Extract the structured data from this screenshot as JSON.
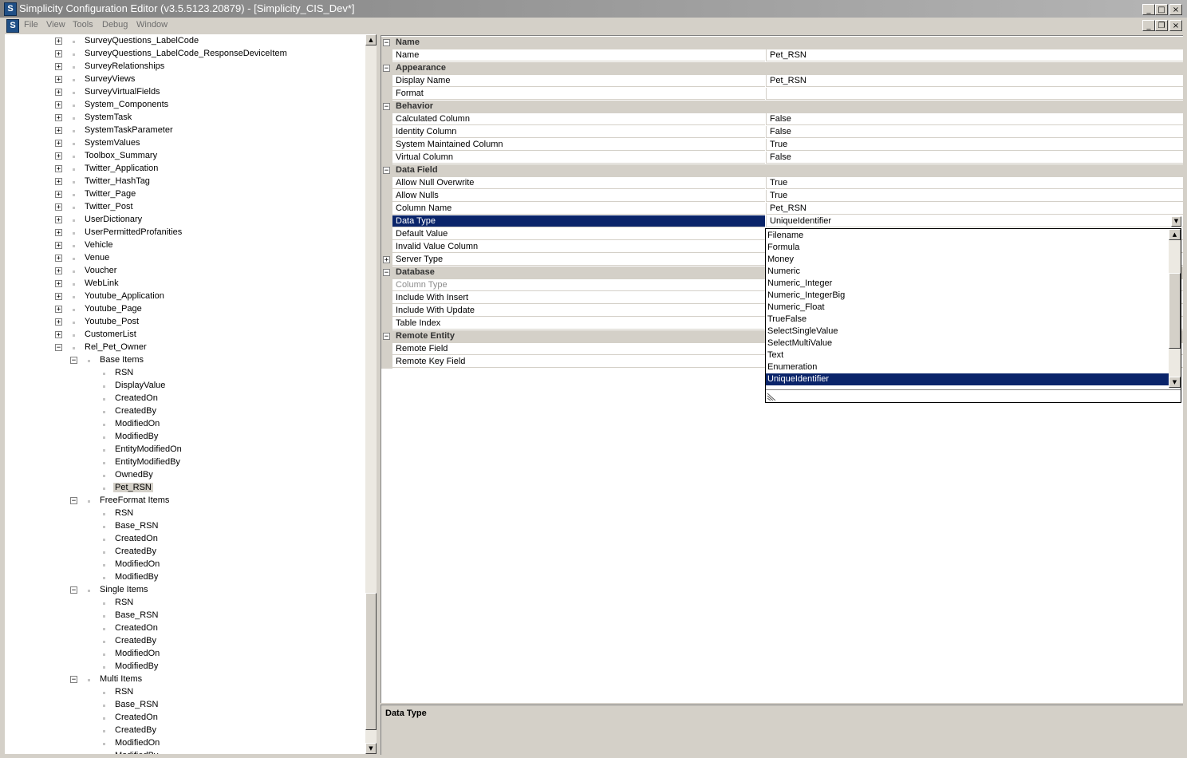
{
  "window": {
    "title": "Simplicity Configuration Editor (v3.5.5123.20879) - [Simplicity_CIS_Dev*]",
    "app_icon_letter": "S",
    "caption_buttons": [
      "_",
      "□",
      "×"
    ]
  },
  "menu": {
    "items": [
      "File",
      "View",
      "Tools",
      "Debug",
      "Window"
    ],
    "mdi_buttons": [
      "_",
      "❐",
      "×"
    ]
  },
  "tree": {
    "nodes": [
      {
        "label": "SurveyQuestions_LabelCode",
        "level": 0,
        "expander": "+"
      },
      {
        "label": "SurveyQuestions_LabelCode_ResponseDeviceItem",
        "level": 0,
        "expander": "+"
      },
      {
        "label": "SurveyRelationships",
        "level": 0,
        "expander": "+"
      },
      {
        "label": "SurveyViews",
        "level": 0,
        "expander": "+"
      },
      {
        "label": "SurveyVirtualFields",
        "level": 0,
        "expander": "+"
      },
      {
        "label": "System_Components",
        "level": 0,
        "expander": "+"
      },
      {
        "label": "SystemTask",
        "level": 0,
        "expander": "+"
      },
      {
        "label": "SystemTaskParameter",
        "level": 0,
        "expander": "+"
      },
      {
        "label": "SystemValues",
        "level": 0,
        "expander": "+"
      },
      {
        "label": "Toolbox_Summary",
        "level": 0,
        "expander": "+"
      },
      {
        "label": "Twitter_Application",
        "level": 0,
        "expander": "+"
      },
      {
        "label": "Twitter_HashTag",
        "level": 0,
        "expander": "+"
      },
      {
        "label": "Twitter_Page",
        "level": 0,
        "expander": "+"
      },
      {
        "label": "Twitter_Post",
        "level": 0,
        "expander": "+"
      },
      {
        "label": "UserDictionary",
        "level": 0,
        "expander": "+"
      },
      {
        "label": "UserPermittedProfanities",
        "level": 0,
        "expander": "+"
      },
      {
        "label": "Vehicle",
        "level": 0,
        "expander": "+"
      },
      {
        "label": "Venue",
        "level": 0,
        "expander": "+"
      },
      {
        "label": "Voucher",
        "level": 0,
        "expander": "+"
      },
      {
        "label": "WebLink",
        "level": 0,
        "expander": "+"
      },
      {
        "label": "Youtube_Application",
        "level": 0,
        "expander": "+"
      },
      {
        "label": "Youtube_Page",
        "level": 0,
        "expander": "+"
      },
      {
        "label": "Youtube_Post",
        "level": 0,
        "expander": "+"
      },
      {
        "label": "CustomerList",
        "level": 0,
        "expander": "+"
      },
      {
        "label": "Rel_Pet_Owner",
        "level": 0,
        "expander": "−"
      },
      {
        "label": "Base Items",
        "level": 1,
        "expander": "−"
      },
      {
        "label": "RSN",
        "level": 2,
        "expander": ""
      },
      {
        "label": "DisplayValue",
        "level": 2,
        "expander": ""
      },
      {
        "label": "CreatedOn",
        "level": 2,
        "expander": ""
      },
      {
        "label": "CreatedBy",
        "level": 2,
        "expander": ""
      },
      {
        "label": "ModifiedOn",
        "level": 2,
        "expander": ""
      },
      {
        "label": "ModifiedBy",
        "level": 2,
        "expander": ""
      },
      {
        "label": "EntityModifiedOn",
        "level": 2,
        "expander": ""
      },
      {
        "label": "EntityModifiedBy",
        "level": 2,
        "expander": ""
      },
      {
        "label": "OwnedBy",
        "level": 2,
        "expander": ""
      },
      {
        "label": "Pet_RSN",
        "level": 2,
        "expander": "",
        "selected": true
      },
      {
        "label": "FreeFormat Items",
        "level": 1,
        "expander": "−"
      },
      {
        "label": "RSN",
        "level": 2,
        "expander": ""
      },
      {
        "label": "Base_RSN",
        "level": 2,
        "expander": ""
      },
      {
        "label": "CreatedOn",
        "level": 2,
        "expander": ""
      },
      {
        "label": "CreatedBy",
        "level": 2,
        "expander": ""
      },
      {
        "label": "ModifiedOn",
        "level": 2,
        "expander": ""
      },
      {
        "label": "ModifiedBy",
        "level": 2,
        "expander": ""
      },
      {
        "label": "Single Items",
        "level": 1,
        "expander": "−"
      },
      {
        "label": "RSN",
        "level": 2,
        "expander": ""
      },
      {
        "label": "Base_RSN",
        "level": 2,
        "expander": ""
      },
      {
        "label": "CreatedOn",
        "level": 2,
        "expander": ""
      },
      {
        "label": "CreatedBy",
        "level": 2,
        "expander": ""
      },
      {
        "label": "ModifiedOn",
        "level": 2,
        "expander": ""
      },
      {
        "label": "ModifiedBy",
        "level": 2,
        "expander": ""
      },
      {
        "label": "Multi Items",
        "level": 1,
        "expander": "−"
      },
      {
        "label": "RSN",
        "level": 2,
        "expander": ""
      },
      {
        "label": "Base_RSN",
        "level": 2,
        "expander": ""
      },
      {
        "label": "CreatedOn",
        "level": 2,
        "expander": ""
      },
      {
        "label": "CreatedBy",
        "level": 2,
        "expander": ""
      },
      {
        "label": "ModifiedOn",
        "level": 2,
        "expander": ""
      },
      {
        "label": "ModifiedBy",
        "level": 2,
        "expander": ""
      }
    ]
  },
  "property_grid": {
    "rows": [
      {
        "type": "category",
        "label": "Name",
        "toggle": "−"
      },
      {
        "type": "property",
        "name": "Name",
        "value": "Pet_RSN"
      },
      {
        "type": "category",
        "label": "Appearance",
        "toggle": "−"
      },
      {
        "type": "property",
        "name": "Display Name",
        "value": "Pet_RSN"
      },
      {
        "type": "property",
        "name": "Format",
        "value": ""
      },
      {
        "type": "category",
        "label": "Behavior",
        "toggle": "−"
      },
      {
        "type": "property",
        "name": "Calculated Column",
        "value": "False"
      },
      {
        "type": "property",
        "name": "Identity Column",
        "value": "False"
      },
      {
        "type": "property",
        "name": "System Maintained Column",
        "value": "True"
      },
      {
        "type": "property",
        "name": "Virtual Column",
        "value": "False"
      },
      {
        "type": "category",
        "label": "Data Field",
        "toggle": "−"
      },
      {
        "type": "property",
        "name": "Allow Null Overwrite",
        "value": "True"
      },
      {
        "type": "property",
        "name": "Allow Nulls",
        "value": "True"
      },
      {
        "type": "property",
        "name": "Column Name",
        "value": "Pet_RSN"
      },
      {
        "type": "property",
        "name": "Data Type",
        "value": "UniqueIdentifier",
        "selected": true,
        "dropdown": true
      },
      {
        "type": "property",
        "name": "Default Value",
        "value": ""
      },
      {
        "type": "property",
        "name": "Invalid Value Column",
        "value": ""
      },
      {
        "type": "property",
        "name": "Server Type",
        "value": "",
        "toggle": "+"
      },
      {
        "type": "category",
        "label": "Database",
        "toggle": "−"
      },
      {
        "type": "property",
        "name": "Column Type",
        "value": "",
        "disabled": true
      },
      {
        "type": "property",
        "name": "Include With Insert",
        "value": ""
      },
      {
        "type": "property",
        "name": "Include With Update",
        "value": ""
      },
      {
        "type": "property",
        "name": "Table Index",
        "value": ""
      },
      {
        "type": "category",
        "label": "Remote Entity",
        "toggle": "−"
      },
      {
        "type": "property",
        "name": "Remote Field",
        "value": ""
      },
      {
        "type": "property",
        "name": "Remote Key Field",
        "value": ""
      }
    ]
  },
  "dropdown": {
    "options": [
      "Filename",
      "Formula",
      "Money",
      "Numeric",
      "Numeric_Integer",
      "Numeric_IntegerBig",
      "Numeric_Float",
      "TrueFalse",
      "SelectSingleValue",
      "SelectMultiValue",
      "Text",
      "Enumeration",
      "UniqueIdentifier"
    ],
    "selected": "UniqueIdentifier"
  },
  "help": {
    "title": "Data Type"
  }
}
